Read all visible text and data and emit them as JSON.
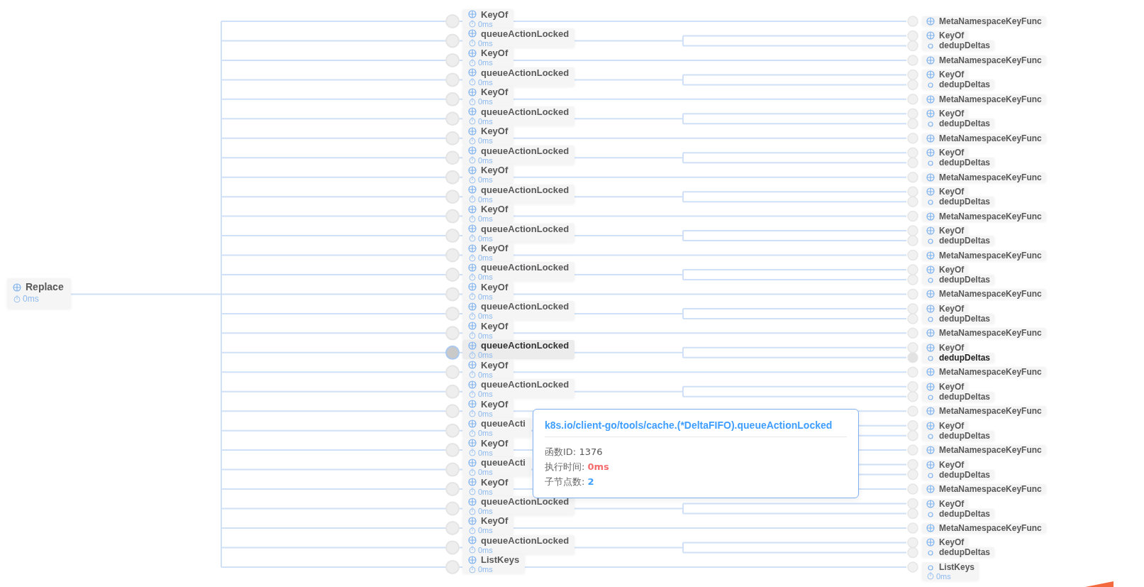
{
  "tree": {
    "title": "Replace",
    "time": "0ms",
    "kind": "branch",
    "children": [
      {
        "title": "KeyOf",
        "time": "0ms",
        "kind": "branch",
        "hovered": false,
        "children": [
          {
            "title": "MetaNamespaceKeyFunc",
            "kind": "branch",
            "highlighted": false
          }
        ]
      },
      {
        "title": "queueActionLocked",
        "time": "0ms",
        "kind": "branch",
        "hovered": false,
        "children": [
          {
            "title": "KeyOf",
            "kind": "branch",
            "highlighted": false
          },
          {
            "title": "dedupDeltas",
            "kind": "leaf",
            "highlighted": false
          }
        ]
      },
      {
        "title": "KeyOf",
        "time": "0ms",
        "kind": "branch",
        "hovered": false,
        "children": [
          {
            "title": "MetaNamespaceKeyFunc",
            "kind": "branch",
            "highlighted": false
          }
        ]
      },
      {
        "title": "queueActionLocked",
        "time": "0ms",
        "kind": "branch",
        "hovered": false,
        "children": [
          {
            "title": "KeyOf",
            "kind": "branch",
            "highlighted": false
          },
          {
            "title": "dedupDeltas",
            "kind": "leaf",
            "highlighted": false
          }
        ]
      },
      {
        "title": "KeyOf",
        "time": "0ms",
        "kind": "branch",
        "hovered": false,
        "children": [
          {
            "title": "MetaNamespaceKeyFunc",
            "kind": "branch",
            "highlighted": false
          }
        ]
      },
      {
        "title": "queueActionLocked",
        "time": "0ms",
        "kind": "branch",
        "hovered": false,
        "children": [
          {
            "title": "KeyOf",
            "kind": "branch",
            "highlighted": false
          },
          {
            "title": "dedupDeltas",
            "kind": "leaf",
            "highlighted": false
          }
        ]
      },
      {
        "title": "KeyOf",
        "time": "0ms",
        "kind": "branch",
        "hovered": false,
        "children": [
          {
            "title": "MetaNamespaceKeyFunc",
            "kind": "branch",
            "highlighted": false
          }
        ]
      },
      {
        "title": "queueActionLocked",
        "time": "0ms",
        "kind": "branch",
        "hovered": false,
        "children": [
          {
            "title": "KeyOf",
            "kind": "branch",
            "highlighted": false
          },
          {
            "title": "dedupDeltas",
            "kind": "leaf",
            "highlighted": false
          }
        ]
      },
      {
        "title": "KeyOf",
        "time": "0ms",
        "kind": "branch",
        "hovered": false,
        "children": [
          {
            "title": "MetaNamespaceKeyFunc",
            "kind": "branch",
            "highlighted": false
          }
        ]
      },
      {
        "title": "queueActionLocked",
        "time": "0ms",
        "kind": "branch",
        "hovered": false,
        "children": [
          {
            "title": "KeyOf",
            "kind": "branch",
            "highlighted": false
          },
          {
            "title": "dedupDeltas",
            "kind": "leaf",
            "highlighted": false
          }
        ]
      },
      {
        "title": "KeyOf",
        "time": "0ms",
        "kind": "branch",
        "hovered": false,
        "children": [
          {
            "title": "MetaNamespaceKeyFunc",
            "kind": "branch",
            "highlighted": false
          }
        ]
      },
      {
        "title": "queueActionLocked",
        "time": "0ms",
        "kind": "branch",
        "hovered": false,
        "children": [
          {
            "title": "KeyOf",
            "kind": "branch",
            "highlighted": false
          },
          {
            "title": "dedupDeltas",
            "kind": "leaf",
            "highlighted": false
          }
        ]
      },
      {
        "title": "KeyOf",
        "time": "0ms",
        "kind": "branch",
        "hovered": false,
        "children": [
          {
            "title": "MetaNamespaceKeyFunc",
            "kind": "branch",
            "highlighted": false
          }
        ]
      },
      {
        "title": "queueActionLocked",
        "time": "0ms",
        "kind": "branch",
        "hovered": false,
        "children": [
          {
            "title": "KeyOf",
            "kind": "branch",
            "highlighted": false
          },
          {
            "title": "dedupDeltas",
            "kind": "leaf",
            "highlighted": false
          }
        ]
      },
      {
        "title": "KeyOf",
        "time": "0ms",
        "kind": "branch",
        "hovered": false,
        "children": [
          {
            "title": "MetaNamespaceKeyFunc",
            "kind": "branch",
            "highlighted": false
          }
        ]
      },
      {
        "title": "queueActionLocked",
        "time": "0ms",
        "kind": "branch",
        "hovered": false,
        "children": [
          {
            "title": "KeyOf",
            "kind": "branch",
            "highlighted": false
          },
          {
            "title": "dedupDeltas",
            "kind": "leaf",
            "highlighted": false
          }
        ]
      },
      {
        "title": "KeyOf",
        "time": "0ms",
        "kind": "branch",
        "hovered": false,
        "children": [
          {
            "title": "MetaNamespaceKeyFunc",
            "kind": "branch",
            "highlighted": false
          }
        ]
      },
      {
        "title": "queueActionLocked",
        "time": "0ms",
        "kind": "branch",
        "hovered": true,
        "children": [
          {
            "title": "KeyOf",
            "kind": "branch",
            "highlighted": false
          },
          {
            "title": "dedupDeltas",
            "kind": "leaf",
            "highlighted": true
          }
        ]
      },
      {
        "title": "KeyOf",
        "time": "0ms",
        "kind": "branch",
        "hovered": false,
        "children": [
          {
            "title": "MetaNamespaceKeyFunc",
            "kind": "branch",
            "highlighted": false
          }
        ]
      },
      {
        "title": "queueActionLocked",
        "time": "0ms",
        "kind": "branch",
        "hovered": false,
        "children": [
          {
            "title": "KeyOf",
            "kind": "branch",
            "highlighted": false
          },
          {
            "title": "dedupDeltas",
            "kind": "leaf",
            "highlighted": false
          }
        ]
      },
      {
        "title": "KeyOf",
        "time": "0ms",
        "kind": "branch",
        "hovered": false,
        "children": [
          {
            "title": "MetaNamespaceKeyFunc",
            "kind": "branch",
            "highlighted": false
          }
        ]
      },
      {
        "title": "queueActi",
        "time": "0ms",
        "kind": "branch",
        "hovered": false,
        "children": [
          {
            "title": "KeyOf",
            "kind": "branch",
            "highlighted": false
          },
          {
            "title": "dedupDeltas",
            "kind": "leaf",
            "highlighted": false
          }
        ]
      },
      {
        "title": "KeyOf",
        "time": "0ms",
        "kind": "branch",
        "hovered": false,
        "children": [
          {
            "title": "MetaNamespaceKeyFunc",
            "kind": "branch",
            "highlighted": false
          }
        ]
      },
      {
        "title": "queueActi",
        "time": "0ms",
        "kind": "branch",
        "hovered": false,
        "children": [
          {
            "title": "KeyOf",
            "kind": "branch",
            "highlighted": false
          },
          {
            "title": "dedupDeltas",
            "kind": "leaf",
            "highlighted": false
          }
        ]
      },
      {
        "title": "KeyOf",
        "time": "0ms",
        "kind": "branch",
        "hovered": false,
        "children": [
          {
            "title": "MetaNamespaceKeyFunc",
            "kind": "branch",
            "highlighted": false
          }
        ]
      },
      {
        "title": "queueActionLocked",
        "time": "0ms",
        "kind": "branch",
        "hovered": false,
        "children": [
          {
            "title": "KeyOf",
            "kind": "branch",
            "highlighted": false
          },
          {
            "title": "dedupDeltas",
            "kind": "leaf",
            "highlighted": false
          }
        ]
      },
      {
        "title": "KeyOf",
        "time": "0ms",
        "kind": "branch",
        "hovered": false,
        "children": [
          {
            "title": "MetaNamespaceKeyFunc",
            "kind": "branch",
            "highlighted": false
          }
        ]
      },
      {
        "title": "queueActionLocked",
        "time": "0ms",
        "kind": "branch",
        "hovered": false,
        "children": [
          {
            "title": "KeyOf",
            "kind": "branch",
            "highlighted": false
          },
          {
            "title": "dedupDeltas",
            "kind": "leaf",
            "highlighted": false
          }
        ]
      },
      {
        "title": "ListKeys",
        "time": "0ms",
        "kind": "branch",
        "hovered": false,
        "children": [
          {
            "title": "ListKeys",
            "time": "0ms",
            "kind": "leaf",
            "highlighted": false
          }
        ]
      }
    ]
  },
  "tooltip": {
    "title": "k8s.io/client-go/tools/cache.(*DeltaFIFO).queueActionLocked",
    "rows": [
      {
        "label": "函数ID:",
        "value": "1376",
        "kind": "plain"
      },
      {
        "label": "执行时间:",
        "value": "0ms",
        "kind": "time"
      },
      {
        "label": "子节点数:",
        "value": "2",
        "kind": "count"
      }
    ]
  }
}
